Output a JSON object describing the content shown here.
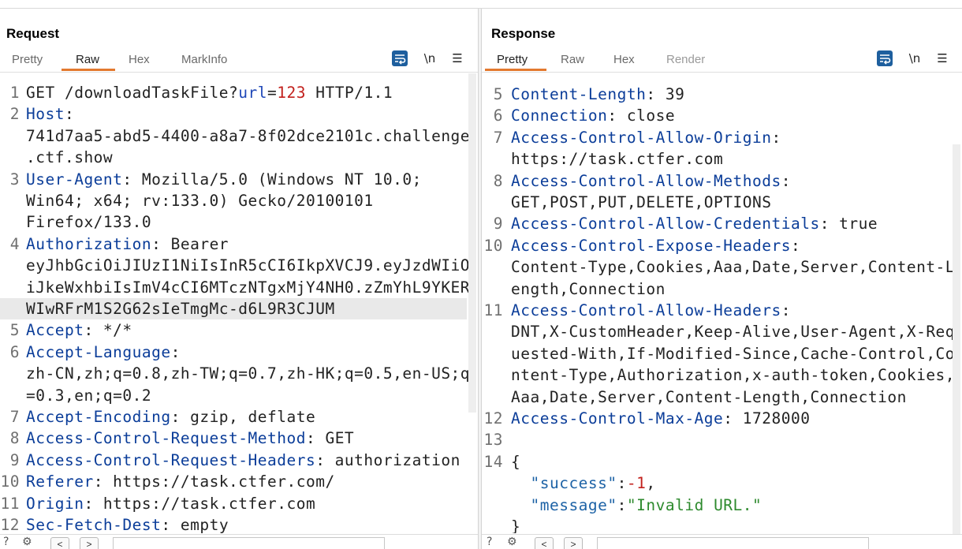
{
  "request": {
    "title": "Request",
    "tabs": [
      "Pretty",
      "Raw",
      "Hex",
      "MarkInfo"
    ],
    "active_tab": "Raw",
    "newline_icon_label": "\\n",
    "lines": [
      {
        "n": "1",
        "parts": [
          [
            "val",
            "GET /downloadTaskFile?"
          ],
          [
            "param",
            "url"
          ],
          [
            "val",
            "="
          ],
          [
            "num",
            "123"
          ],
          [
            "val",
            " HTTP/1.1"
          ]
        ]
      },
      {
        "n": "2",
        "parts": [
          [
            "hdr",
            "Host"
          ],
          [
            "val",
            ":"
          ]
        ]
      },
      {
        "n": "",
        "parts": [
          [
            "val",
            "741d7aa5-abd5-4400-a8a7-8f02dce2101c.challenge"
          ]
        ]
      },
      {
        "n": "",
        "parts": [
          [
            "val",
            ".ctf.show"
          ]
        ]
      },
      {
        "n": "3",
        "parts": [
          [
            "hdr",
            "User-Agent"
          ],
          [
            "val",
            ": Mozilla/5.0 (Windows NT 10.0;"
          ]
        ]
      },
      {
        "n": "",
        "parts": [
          [
            "val",
            "Win64; x64; rv:133.0) Gecko/20100101"
          ]
        ]
      },
      {
        "n": "",
        "parts": [
          [
            "val",
            "Firefox/133.0"
          ]
        ]
      },
      {
        "n": "4",
        "parts": [
          [
            "hdr",
            "Authorization"
          ],
          [
            "val",
            ": Bearer"
          ]
        ]
      },
      {
        "n": "",
        "parts": [
          [
            "val",
            "eyJhbGciOiJIUzI1NiIsInR5cCI6IkpXVCJ9.eyJzdWIiO"
          ]
        ]
      },
      {
        "n": "",
        "parts": [
          [
            "val",
            "iJkeWxhbiIsImV4cCI6MTczNTgxMjY4NH0.zZmYhL9YKER"
          ]
        ]
      },
      {
        "n": "",
        "hl": true,
        "parts": [
          [
            "val",
            "WIwRFrM1S2G62sIeTmgMc-d6L9R3CJUM"
          ]
        ]
      },
      {
        "n": "5",
        "parts": [
          [
            "hdr",
            "Accept"
          ],
          [
            "val",
            ": */*"
          ]
        ]
      },
      {
        "n": "6",
        "parts": [
          [
            "hdr",
            "Accept-Language"
          ],
          [
            "val",
            ":"
          ]
        ]
      },
      {
        "n": "",
        "parts": [
          [
            "val",
            "zh-CN,zh;q=0.8,zh-TW;q=0.7,zh-HK;q=0.5,en-US;q"
          ]
        ]
      },
      {
        "n": "",
        "parts": [
          [
            "val",
            "=0.3,en;q=0.2"
          ]
        ]
      },
      {
        "n": "7",
        "parts": [
          [
            "hdr",
            "Accept-Encoding"
          ],
          [
            "val",
            ": gzip, deflate"
          ]
        ]
      },
      {
        "n": "8",
        "parts": [
          [
            "hdr",
            "Access-Control-Request-Method"
          ],
          [
            "val",
            ": GET"
          ]
        ]
      },
      {
        "n": "9",
        "parts": [
          [
            "hdr",
            "Access-Control-Request-Headers"
          ],
          [
            "val",
            ": authorization"
          ]
        ]
      },
      {
        "n": "10",
        "parts": [
          [
            "hdr",
            "Referer"
          ],
          [
            "val",
            ": https://task.ctfer.com/"
          ]
        ]
      },
      {
        "n": "11",
        "parts": [
          [
            "hdr",
            "Origin"
          ],
          [
            "val",
            ": https://task.ctfer.com"
          ]
        ]
      },
      {
        "n": "12",
        "parts": [
          [
            "hdr",
            "Sec-Fetch-Dest"
          ],
          [
            "val",
            ": empty"
          ]
        ]
      }
    ]
  },
  "response": {
    "title": "Response",
    "tabs": [
      "Pretty",
      "Raw",
      "Hex",
      "Render"
    ],
    "active_tab": "Pretty",
    "newline_icon_label": "\\n",
    "lines": [
      {
        "n": "5",
        "parts": [
          [
            "hdr",
            "Content-Length"
          ],
          [
            "val",
            ": 39"
          ]
        ]
      },
      {
        "n": "6",
        "parts": [
          [
            "hdr",
            "Connection"
          ],
          [
            "val",
            ": close"
          ]
        ]
      },
      {
        "n": "7",
        "parts": [
          [
            "hdr",
            "Access-Control-Allow-Origin"
          ],
          [
            "val",
            ":"
          ]
        ]
      },
      {
        "n": "",
        "parts": [
          [
            "val",
            "https://task.ctfer.com"
          ]
        ]
      },
      {
        "n": "8",
        "parts": [
          [
            "hdr",
            "Access-Control-Allow-Methods"
          ],
          [
            "val",
            ":"
          ]
        ]
      },
      {
        "n": "",
        "parts": [
          [
            "val",
            "GET,POST,PUT,DELETE,OPTIONS"
          ]
        ]
      },
      {
        "n": "9",
        "parts": [
          [
            "hdr",
            "Access-Control-Allow-Credentials"
          ],
          [
            "val",
            ": true"
          ]
        ]
      },
      {
        "n": "10",
        "parts": [
          [
            "hdr",
            "Access-Control-Expose-Headers"
          ],
          [
            "val",
            ":"
          ]
        ]
      },
      {
        "n": "",
        "parts": [
          [
            "val",
            "Content-Type,Cookies,Aaa,Date,Server,Content-L"
          ]
        ]
      },
      {
        "n": "",
        "parts": [
          [
            "val",
            "ength,Connection"
          ]
        ]
      },
      {
        "n": "11",
        "parts": [
          [
            "hdr",
            "Access-Control-Allow-Headers"
          ],
          [
            "val",
            ":"
          ]
        ]
      },
      {
        "n": "",
        "parts": [
          [
            "val",
            "DNT,X-CustomHeader,Keep-Alive,User-Agent,X-Req"
          ]
        ]
      },
      {
        "n": "",
        "parts": [
          [
            "val",
            "uested-With,If-Modified-Since,Cache-Control,Co"
          ]
        ]
      },
      {
        "n": "",
        "parts": [
          [
            "val",
            "ntent-Type,Authorization,x-auth-token,Cookies,"
          ]
        ]
      },
      {
        "n": "",
        "parts": [
          [
            "val",
            "Aaa,Date,Server,Content-Length,Connection"
          ]
        ]
      },
      {
        "n": "12",
        "parts": [
          [
            "hdr",
            "Access-Control-Max-Age"
          ],
          [
            "val",
            ": 1728000"
          ]
        ]
      },
      {
        "n": "13",
        "parts": []
      },
      {
        "n": "14",
        "parts": [
          [
            "val",
            "{"
          ]
        ]
      },
      {
        "n": "",
        "parts": [
          [
            "val",
            "  "
          ],
          [
            "jkey",
            "\"success\""
          ],
          [
            "val",
            ":"
          ],
          [
            "jnum",
            "-1"
          ],
          [
            "val",
            ","
          ]
        ]
      },
      {
        "n": "",
        "parts": [
          [
            "val",
            "  "
          ],
          [
            "jkey",
            "\"message\""
          ],
          [
            "val",
            ":"
          ],
          [
            "jstr",
            "\"Invalid URL.\""
          ]
        ]
      },
      {
        "n": "",
        "parts": [
          [
            "val",
            "}"
          ]
        ]
      }
    ]
  },
  "icons": {
    "wrap": "wrap-lines-icon",
    "newline": "show-newlines-icon",
    "menu": "hamburger-menu-icon",
    "layout": [
      "side-by-side-layout-icon",
      "stacked-layout-icon",
      "single-pane-layout-icon"
    ]
  },
  "colors": {
    "header_name": "#0b3d99",
    "tab_underline": "#e3792f",
    "accent_button": "#1f5f9f",
    "json_string": "#2e8a2e",
    "json_number": "#c2201c"
  }
}
